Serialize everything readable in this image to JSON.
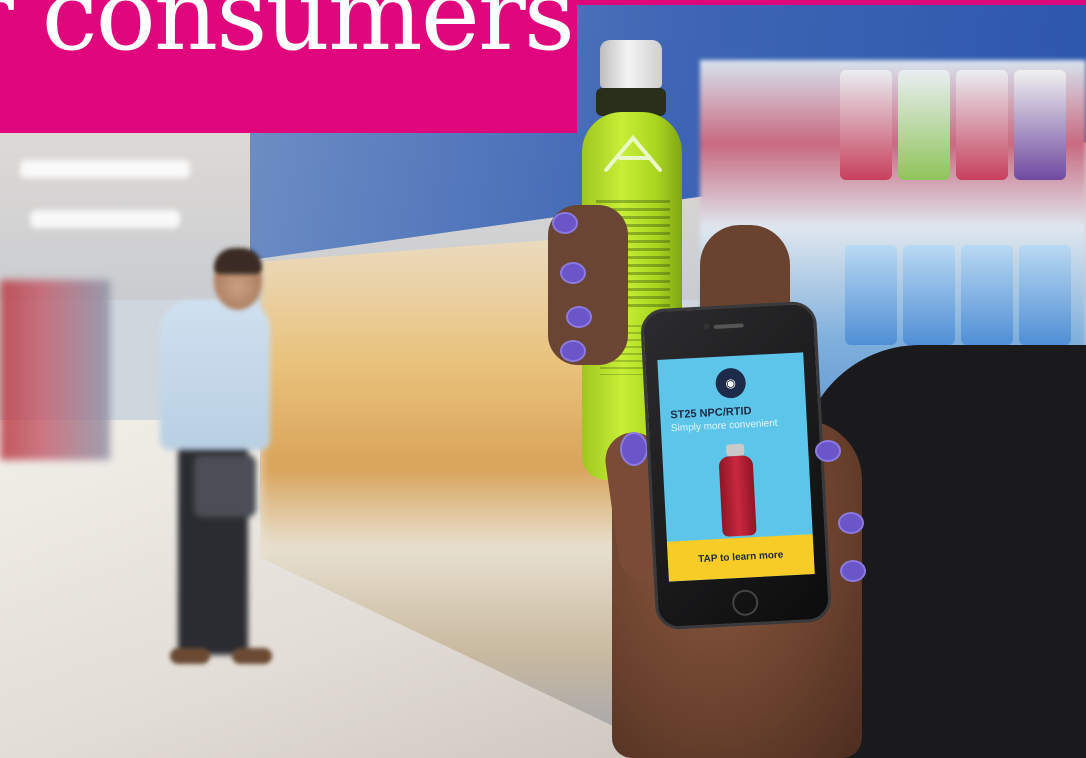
{
  "banner": {
    "title": "r consumers",
    "background_color": "#e0077d"
  },
  "phone_app": {
    "logo_icon": "bottle-scan-logo-icon",
    "product_code": "ST25 NPC/RTID",
    "subtitle": "Simply more convenient",
    "cta_label": "TAP to learn more",
    "screen_color": "#5ec5ea",
    "cta_color": "#f7cc27"
  },
  "scene": {
    "description_icons": [
      "green-bottle-icon",
      "red-bottle-icon"
    ]
  }
}
